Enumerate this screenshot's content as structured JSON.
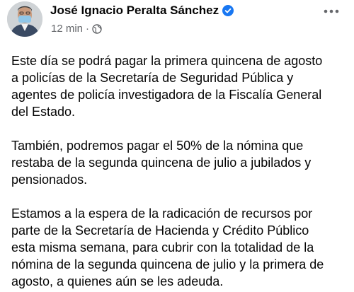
{
  "post": {
    "author": "José Ignacio Peralta Sánchez",
    "verified": true,
    "timestamp": "12 min",
    "separator": "·",
    "audience_icon": "globe-icon",
    "more_icon": "more-options-icon",
    "paragraphs": [
      "Este día se podrá pagar la primera quincena de agosto\na policías de la Secretaría de Seguridad Pública y\nagentes de policía investigadora de la Fiscalía General\ndel Estado.",
      "También, podremos pagar el 50% de la nómina que\nrestaba de la segunda quincena de julio a jubilados y\npensionados.",
      "Estamos a la espera de la radicación de recursos por\nparte de la Secretaría de Hacienda y Crédito Público\nesta misma semana, para cubrir con la totalidad de la\nnómina de la segunda quincena de julio y la primera de\nagosto, a quienes aún se les adeuda."
    ]
  },
  "colors": {
    "verified_badge": "#1877f2",
    "secondary_text": "#65676b",
    "primary_text": "#050505"
  }
}
